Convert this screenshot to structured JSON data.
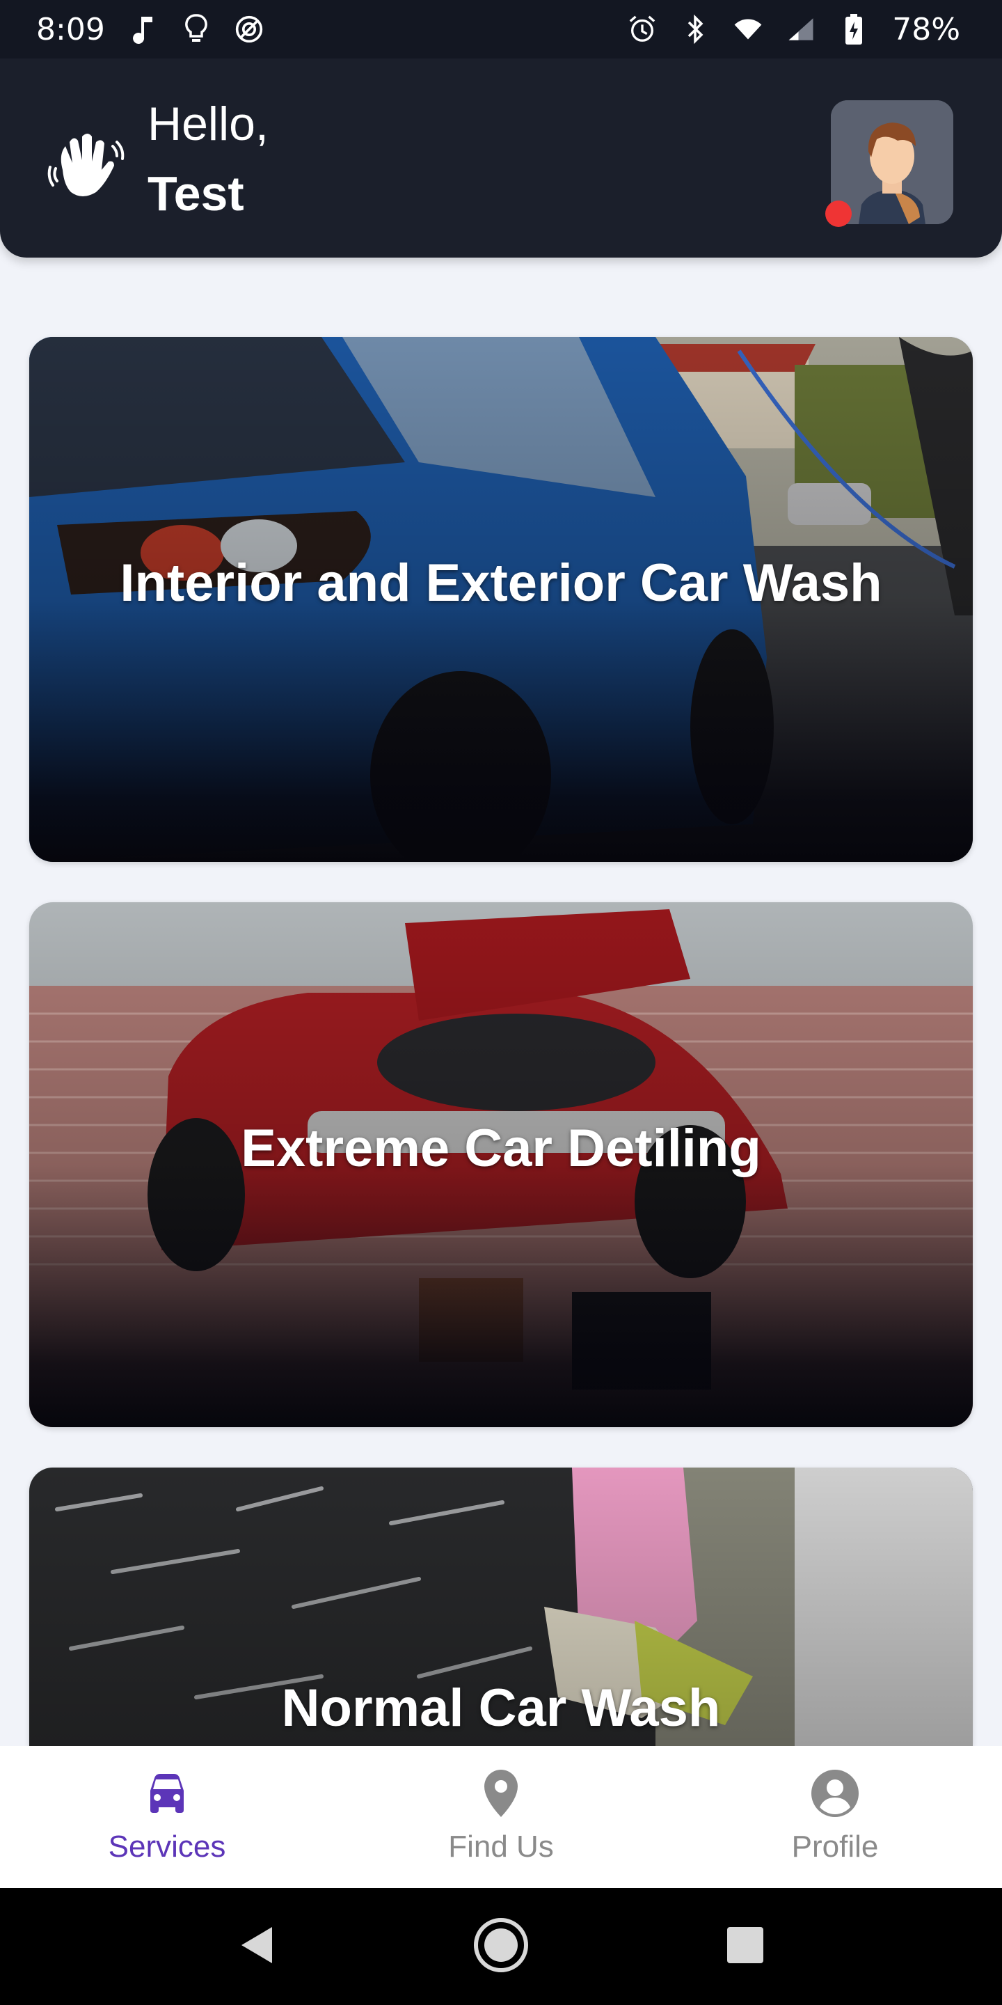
{
  "status_bar": {
    "time": "8:09",
    "battery": "78%",
    "icons": [
      "music-note-icon",
      "lightbulb-icon",
      "at-sign-icon",
      "alarm-icon",
      "bluetooth-icon",
      "wifi-icon",
      "signal-icon",
      "battery-icon"
    ]
  },
  "header": {
    "greeting": "Hello,",
    "name": "Test",
    "wave_icon": "waving-hand-icon",
    "status_dot_color": "#ef3434"
  },
  "services": [
    {
      "title": "Interior and Exterior Car Wash"
    },
    {
      "title": "Extreme Car Detiling"
    },
    {
      "title": "Normal Car Wash"
    }
  ],
  "bottom_nav": {
    "active_color": "#5c35b8",
    "items": [
      {
        "label": "Services",
        "icon": "car-icon",
        "active": true
      },
      {
        "label": "Find Us",
        "icon": "location-pin-icon",
        "active": false
      },
      {
        "label": "Profile",
        "icon": "account-circle-icon",
        "active": false
      }
    ]
  },
  "system_nav": {
    "icons": [
      "back-icon",
      "home-icon",
      "recents-icon"
    ]
  }
}
